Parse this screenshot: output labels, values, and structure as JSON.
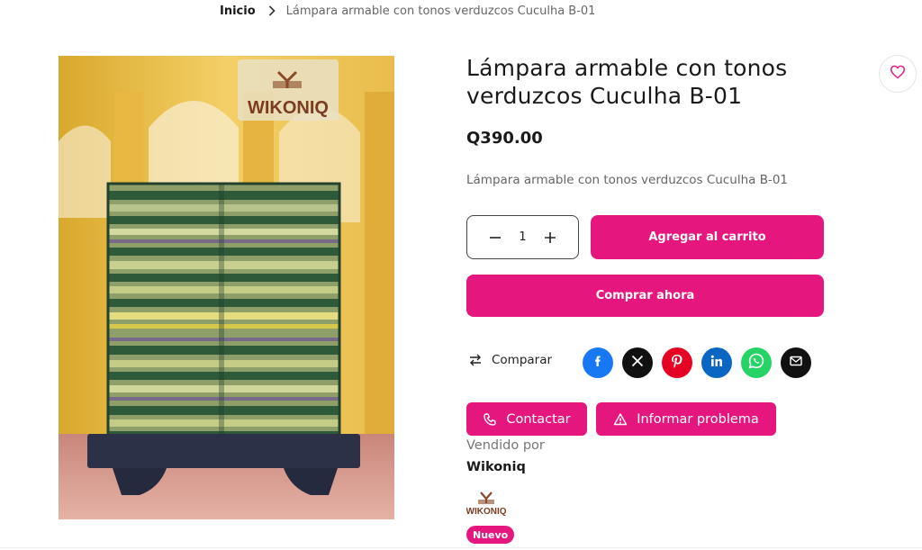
{
  "breadcrumb": {
    "home": "Inicio",
    "current": "Lámpara armable con tonos verduzcos Cuculha B-01"
  },
  "product": {
    "title": "Lámpara armable con tonos verduzcos Cuculha B-01",
    "price": "Q390.00",
    "description": "Lámpara armable con tonos verduzcos Cuculha B-01",
    "image_brand": "WIKONIQ"
  },
  "quantity": {
    "value": "1",
    "decrease_icon": "minus-icon",
    "increase_icon": "plus-icon"
  },
  "actions": {
    "add_to_cart": "Agregar al carrito",
    "buy_now": "Comprar ahora",
    "compare": "Comparar",
    "contact": "Contactar",
    "report": "Informar problema"
  },
  "share": [
    {
      "network": "facebook",
      "icon": "facebook-icon",
      "color": "#1877f2"
    },
    {
      "network": "x",
      "icon": "x-icon",
      "color": "#111111"
    },
    {
      "network": "pinterest",
      "icon": "pinterest-icon",
      "color": "#e60023"
    },
    {
      "network": "linkedin",
      "icon": "linkedin-icon",
      "color": "#0a66c2"
    },
    {
      "network": "whatsapp",
      "icon": "whatsapp-icon",
      "color": "#25d366"
    },
    {
      "network": "email",
      "icon": "envelope-icon",
      "color": "#111111"
    }
  ],
  "seller": {
    "sold_by_label": "Vendido por",
    "name": "Wikoniq",
    "logo_text": "WIKONIQ",
    "badge": "Nuevo"
  },
  "colors": {
    "accent": "#e5177f",
    "text": "#1a1a1a",
    "muted": "#666666"
  }
}
